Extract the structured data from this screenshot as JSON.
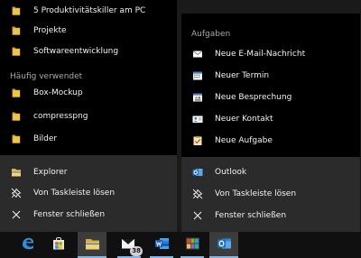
{
  "explorer_jumplist": {
    "pinned_items": [
      {
        "label": "5 Produktivitätskiller am PC",
        "icon": "folder-icon"
      },
      {
        "label": "Projekte",
        "icon": "folder-icon"
      },
      {
        "label": "Softwareentwicklung",
        "icon": "folder-icon"
      }
    ],
    "frequent_header": "Häufig verwendet",
    "frequent_items": [
      {
        "label": "Box-Mockup",
        "icon": "folder-icon"
      },
      {
        "label": "compresspng",
        "icon": "folder-icon"
      },
      {
        "label": "Bilder",
        "icon": "folder-icon"
      }
    ],
    "actions": [
      {
        "label": "Explorer",
        "icon": "file-explorer-icon"
      },
      {
        "label": "Von Taskleiste lösen",
        "icon": "unpin-icon"
      },
      {
        "label": "Fenster schließen",
        "icon": "close-icon"
      }
    ]
  },
  "outlook_jumplist": {
    "tasks_header": "Aufgaben",
    "tasks": [
      {
        "label": "Neue E-Mail-Nachricht",
        "icon": "new-mail-icon"
      },
      {
        "label": "Neuer Termin",
        "icon": "calendar-icon"
      },
      {
        "label": "Neue Besprechung",
        "icon": "meeting-icon"
      },
      {
        "label": "Neuer Kontakt",
        "icon": "contact-card-icon"
      },
      {
        "label": "Neue Aufgabe",
        "icon": "task-icon"
      }
    ],
    "actions": [
      {
        "label": "Outlook",
        "icon": "outlook-icon"
      },
      {
        "label": "Von Taskleiste lösen",
        "icon": "unpin-icon"
      },
      {
        "label": "Fenster schließen",
        "icon": "close-icon"
      }
    ]
  },
  "taskbar": {
    "apps": [
      {
        "name": "Microsoft Edge",
        "icon": "edge-icon"
      },
      {
        "name": "Microsoft Store",
        "icon": "store-icon"
      },
      {
        "name": "Explorer",
        "icon": "file-explorer-icon",
        "state": "active"
      },
      {
        "name": "Mail",
        "icon": "mail-icon",
        "badge": "38"
      },
      {
        "name": "Word",
        "icon": "word-icon"
      },
      {
        "name": "Photo app",
        "icon": "photo-app-icon"
      },
      {
        "name": "Outlook",
        "icon": "outlook-icon",
        "state": "active"
      }
    ]
  },
  "colors": {
    "folder": "#f0c44a",
    "accent_line": "#7fb7e8",
    "menu_dark": "#000000",
    "menu_light": "#2b2b2b",
    "taskbar": "#101010"
  }
}
